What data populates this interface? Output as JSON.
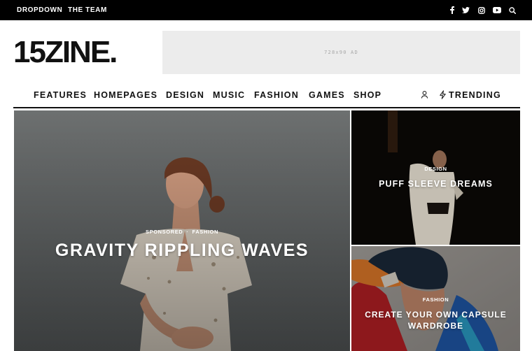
{
  "topbar": {
    "links": [
      "DROPDOWN",
      "THE TEAM"
    ],
    "icons": [
      "facebook-icon",
      "twitter-icon",
      "instagram-icon",
      "youtube-icon",
      "search-icon"
    ]
  },
  "header": {
    "logo": "15ZINE.",
    "ad_label": "728x90 AD"
  },
  "nav": {
    "items": [
      "FEATURES",
      "HOMEPAGES",
      "DESIGN",
      "MUSIC",
      "FASHION",
      "GAMES",
      "SHOP"
    ],
    "trending": "TRENDING",
    "icons": [
      "user-icon",
      "bolt-icon"
    ]
  },
  "hero": {
    "main": {
      "categories": [
        "SPONSORED",
        "FASHION"
      ],
      "separator": "·",
      "title": "GRAVITY RIPPLING WAVES"
    },
    "side_top": {
      "category": "DESIGN",
      "title": "PUFF SLEEVE DREAMS"
    },
    "side_bottom": {
      "category": "FASHION",
      "title": "CREATE YOUR OWN CAPSULE WARDROBE"
    }
  },
  "colors": {
    "topbar_bg": "#000000",
    "text": "#111111",
    "ad_bg": "#ececec"
  }
}
